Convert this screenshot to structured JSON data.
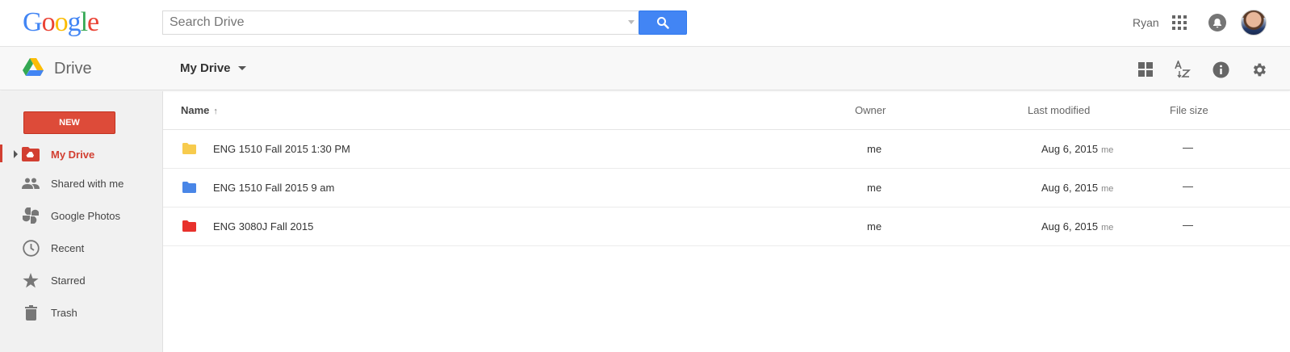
{
  "header": {
    "logo_letters": [
      {
        "char": "G",
        "color": "#4285f4"
      },
      {
        "char": "o",
        "color": "#ea4335"
      },
      {
        "char": "o",
        "color": "#fbbc05"
      },
      {
        "char": "g",
        "color": "#4285f4"
      },
      {
        "char": "l",
        "color": "#34a853"
      },
      {
        "char": "e",
        "color": "#ea4335"
      }
    ],
    "search_placeholder": "Search Drive",
    "user_name": "Ryan"
  },
  "subbar": {
    "app_name": "Drive",
    "breadcrumb": "My Drive"
  },
  "sidebar": {
    "new_label": "NEW",
    "items": [
      {
        "label": "My Drive",
        "icon": "my-drive-icon",
        "active": true
      },
      {
        "label": "Shared with me",
        "icon": "people-icon",
        "active": false
      },
      {
        "label": "Google Photos",
        "icon": "photos-icon",
        "active": false
      },
      {
        "label": "Recent",
        "icon": "clock-icon",
        "active": false
      },
      {
        "label": "Starred",
        "icon": "star-icon",
        "active": false
      },
      {
        "label": "Trash",
        "icon": "trash-icon",
        "active": false
      }
    ]
  },
  "list": {
    "columns": {
      "name": "Name",
      "owner": "Owner",
      "last_modified": "Last modified",
      "file_size": "File size"
    },
    "rows": [
      {
        "name": "ENG 1510 Fall 2015 1:30 PM",
        "folder_color": "#f7cb4d",
        "owner": "me",
        "modified": "Aug 6, 2015",
        "modified_by": "me",
        "size": "—"
      },
      {
        "name": "ENG 1510 Fall 2015 9 am",
        "folder_color": "#4986e7",
        "owner": "me",
        "modified": "Aug 6, 2015",
        "modified_by": "me",
        "size": "—"
      },
      {
        "name": "ENG 3080J Fall 2015",
        "folder_color": "#e8312c",
        "owner": "me",
        "modified": "Aug 6, 2015",
        "modified_by": "me",
        "size": "—"
      }
    ]
  },
  "colors": {
    "accent_red": "#dd4b39",
    "search_blue": "#4285f4"
  }
}
